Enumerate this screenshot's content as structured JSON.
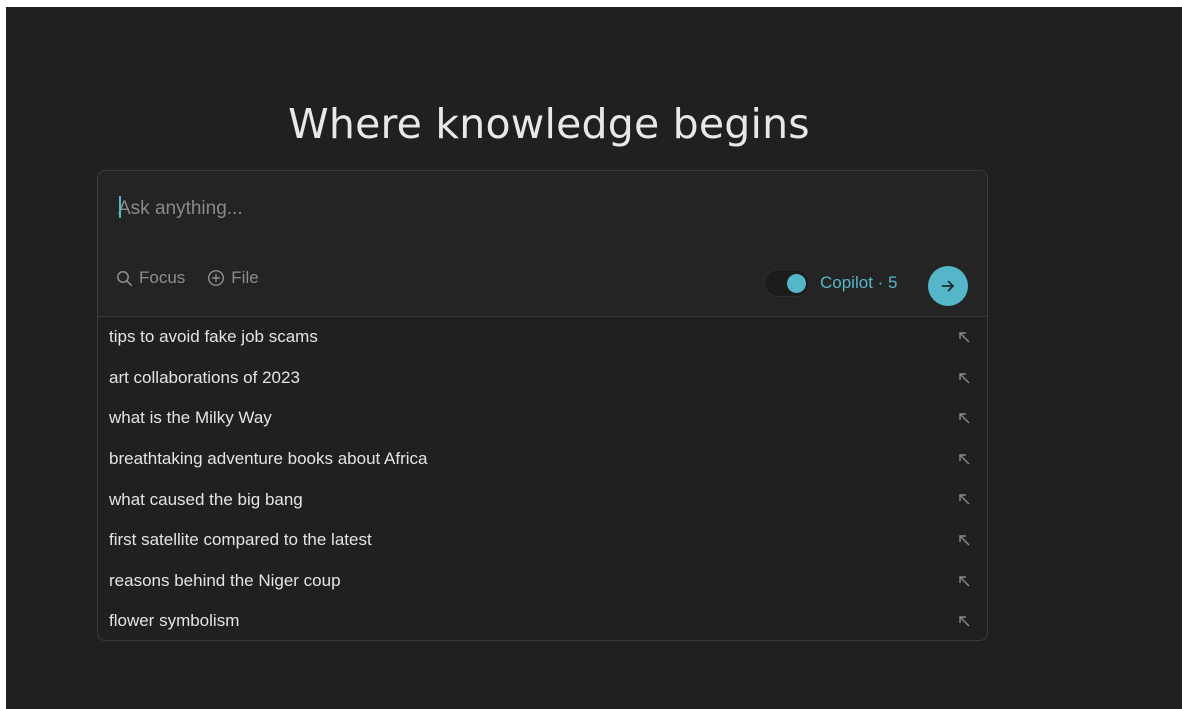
{
  "hero": {
    "title": "Where knowledge begins"
  },
  "search": {
    "placeholder": "Ask anything...",
    "value": "",
    "tools": [
      {
        "label": "Focus",
        "icon": "search-icon"
      },
      {
        "label": "File",
        "icon": "plus-circle-icon"
      }
    ],
    "copilot": {
      "label": "Copilot · 5",
      "enabled": true
    },
    "submit_icon": "arrow-right-icon"
  },
  "suggestions": [
    "tips to avoid fake job scams",
    "art collaborations of 2023",
    "what is the Milky Way",
    "breathtaking adventure books about Africa",
    "what caused the big bang",
    "first satellite compared to the latest",
    "reasons behind the Niger coup",
    "flower symbolism"
  ],
  "suggestion_icon": "arrow-up-left-icon",
  "colors": {
    "background": "#202020",
    "accent": "#56b6c9",
    "text": "#e4e4e2",
    "muted": "#8e8e8e",
    "border": "#3b3b3b"
  }
}
